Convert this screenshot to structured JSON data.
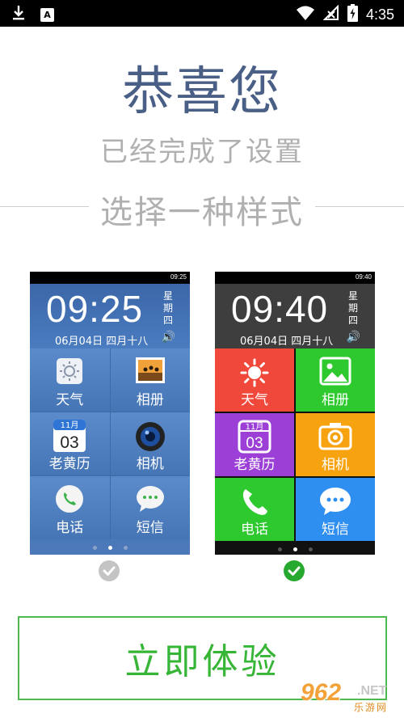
{
  "status_bar": {
    "time": "4:35",
    "left_icons": [
      "download-icon",
      "app-a-icon"
    ],
    "app_badge": "A",
    "right_icons": [
      "wifi-icon",
      "no-signal-icon",
      "battery-charging-icon"
    ]
  },
  "header": {
    "title": "恭喜您",
    "subtitle": "已经完成了设置",
    "choose_label": "选择一种样式"
  },
  "themes": [
    {
      "status_time": "09:25",
      "clock": "09:25",
      "weekday": [
        "星",
        "期",
        "四"
      ],
      "date": "06月04日  四月十八",
      "tiles": [
        {
          "label": "天气",
          "icon": "weather-icon"
        },
        {
          "label": "相册",
          "icon": "album-icon"
        },
        {
          "label": "老黄历",
          "icon": "calendar-icon",
          "calendar_month": "11月",
          "calendar_day": "03"
        },
        {
          "label": "相机",
          "icon": "camera-icon"
        },
        {
          "label": "电话",
          "icon": "phone-icon"
        },
        {
          "label": "短信",
          "icon": "sms-icon"
        }
      ],
      "selected": false
    },
    {
      "status_time": "09:40",
      "clock": "09:40",
      "weekday": [
        "星",
        "期",
        "四"
      ],
      "date": "06月04日  四月十八",
      "tiles": [
        {
          "label": "天气",
          "icon": "weather-icon",
          "color": "#f0493c"
        },
        {
          "label": "相册",
          "icon": "album-icon",
          "color": "#2ec92e"
        },
        {
          "label": "老黄历",
          "icon": "calendar-icon",
          "color": "#9b3fd6",
          "calendar_month": "11月",
          "calendar_day": "03"
        },
        {
          "label": "相机",
          "icon": "camera-icon",
          "color": "#f7a20f"
        },
        {
          "label": "电话",
          "icon": "phone-icon",
          "color": "#2ec92e"
        },
        {
          "label": "短信",
          "icon": "sms-icon",
          "color": "#2f8ff0"
        }
      ],
      "selected": true
    }
  ],
  "start_button": {
    "label": "立即体验"
  },
  "watermark": {
    "big": "962",
    "net": ".NET",
    "cn": "乐游网"
  },
  "colors": {
    "title": "#4a5f86",
    "button_border": "#4fb84f",
    "button_text": "#36b536",
    "check_selected": "#27a82f",
    "check_unselected": "#c4c4c4"
  }
}
